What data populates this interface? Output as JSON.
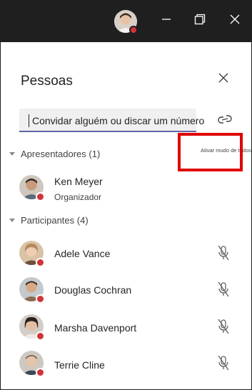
{
  "window": {
    "titlebar_bg": "#1f1f1f",
    "icons": [
      "minimize-icon",
      "restore-icon",
      "close-icon"
    ]
  },
  "panel": {
    "title": "Pessoas",
    "search_placeholder": "Convidar alguém ou discar um número",
    "mute_all_label": "Ativar mudo de todos",
    "accent": "#6264a7",
    "status_color": "#d13438",
    "highlight_color": "#e00000"
  },
  "presenters": {
    "label": "Apresentadores (1)",
    "items": [
      {
        "name": "Ken Meyer",
        "role": "Organizador"
      }
    ]
  },
  "attendees": {
    "label": "Participantes (4)",
    "items": [
      {
        "name": "Adele Vance"
      },
      {
        "name": "Douglas Cochran"
      },
      {
        "name": "Marsha Davenport"
      },
      {
        "name": "Terrie Cline"
      }
    ]
  }
}
